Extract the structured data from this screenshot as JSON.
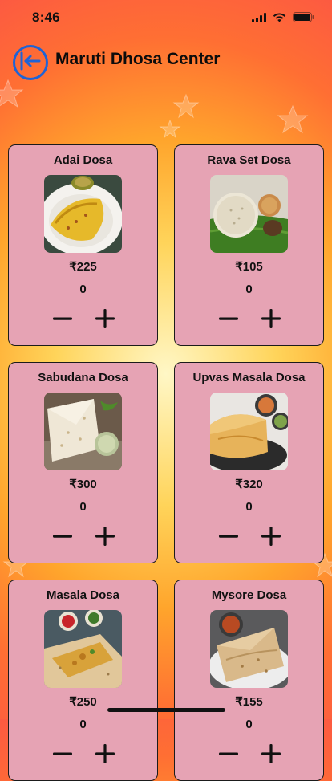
{
  "status_bar": {
    "time": "8:46",
    "icons": [
      "signal-icon",
      "wifi-icon",
      "battery-icon"
    ]
  },
  "header": {
    "back_icon": "arrow-left-into-bracket-icon",
    "title": "Maruti Dhosa Center"
  },
  "colors": {
    "card_background": "#e6a3b4",
    "back_button_accent": "#1e63d6",
    "background_outer": "#fb4f49",
    "background_center": "#fff7c6"
  },
  "menu": {
    "items": [
      {
        "name": "Adai Dosa",
        "price": "₹225",
        "quantity": "0",
        "image": "adai-dosa-photo"
      },
      {
        "name": "Rava Set Dosa",
        "price": "₹105",
        "quantity": "0",
        "image": "rava-set-dosa-photo"
      },
      {
        "name": "Sabudana Dosa",
        "price": "₹300",
        "quantity": "0",
        "image": "sabudana-dosa-photo"
      },
      {
        "name": "Upvas Masala Dosa",
        "price": "₹320",
        "quantity": "0",
        "image": "upvas-masala-dosa-photo"
      },
      {
        "name": "Masala Dosa",
        "price": "₹250",
        "quantity": "0",
        "image": "masala-dosa-photo"
      },
      {
        "name": "Mysore Dosa",
        "price": "₹155",
        "quantity": "0",
        "image": "mysore-dosa-photo"
      }
    ]
  }
}
